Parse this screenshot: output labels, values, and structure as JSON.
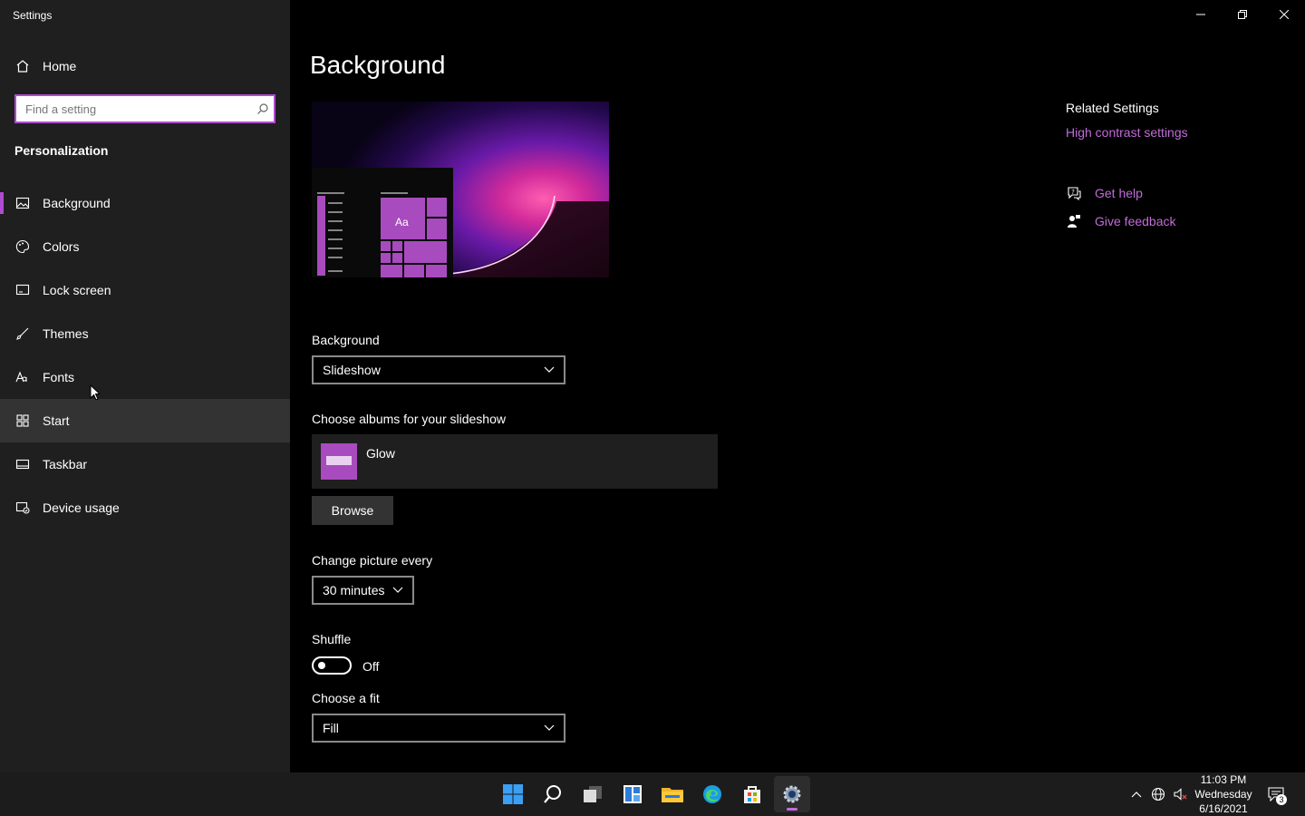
{
  "window": {
    "title": "Settings",
    "controls": {
      "minimize": "minimize-icon",
      "restore": "restore-icon",
      "close": "close-icon"
    }
  },
  "sidebar": {
    "home_label": "Home",
    "search_placeholder": "Find a setting",
    "section_title": "Personalization",
    "items": [
      {
        "label": "Background",
        "icon": "picture-icon",
        "active": true
      },
      {
        "label": "Colors",
        "icon": "palette-icon"
      },
      {
        "label": "Lock screen",
        "icon": "lock-screen-icon"
      },
      {
        "label": "Themes",
        "icon": "brush-icon"
      },
      {
        "label": "Fonts",
        "icon": "font-icon"
      },
      {
        "label": "Start",
        "icon": "start-grid-icon",
        "hover": true
      },
      {
        "label": "Taskbar",
        "icon": "taskbar-icon"
      },
      {
        "label": "Device usage",
        "icon": "device-usage-icon"
      }
    ]
  },
  "main": {
    "title": "Background",
    "preview_tile_text": "Aa",
    "background_label": "Background",
    "background_value": "Slideshow",
    "albums_label": "Choose albums for your slideshow",
    "album_name": "Glow",
    "browse_label": "Browse",
    "change_label": "Change picture every",
    "change_value": "30 minutes",
    "shuffle_label": "Shuffle",
    "shuffle_state": "Off",
    "fit_label": "Choose a fit",
    "fit_value": "Fill"
  },
  "related": {
    "title": "Related Settings",
    "high_contrast": "High contrast settings",
    "get_help": "Get help",
    "give_feedback": "Give feedback"
  },
  "taskbar": {
    "time": "11:03 PM",
    "day": "Wednesday",
    "date": "6/16/2021",
    "notification_count": "3"
  },
  "colors": {
    "accent": "#b04bd0",
    "link": "#c26cd8",
    "sidebar_bg": "#1f1f1f"
  }
}
